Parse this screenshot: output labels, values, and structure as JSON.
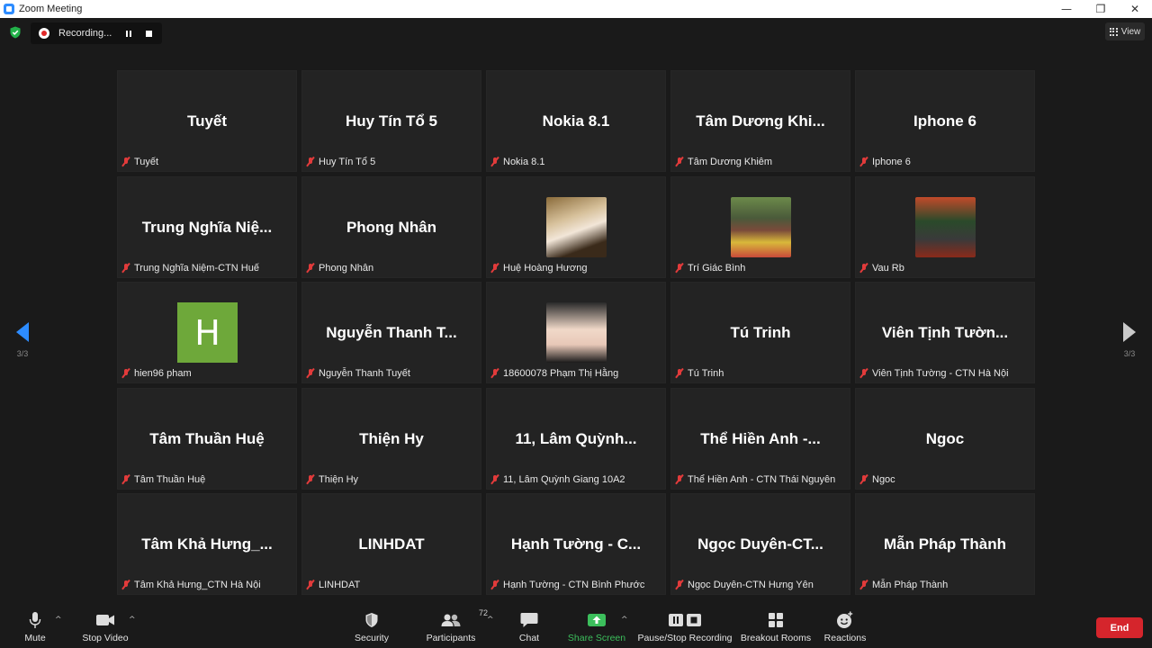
{
  "window": {
    "title": "Zoom Meeting"
  },
  "recording": {
    "label": "Recording..."
  },
  "view_button": {
    "label": "View"
  },
  "pagination": {
    "left": "3/3",
    "right": "3/3"
  },
  "participants": [
    {
      "display": "Tuyết",
      "name": "Tuyết",
      "avatar": ""
    },
    {
      "display": "Huy Tín Tổ 5",
      "name": "Huy Tín Tổ 5",
      "avatar": ""
    },
    {
      "display": "Nokia 8.1",
      "name": "Nokia 8.1",
      "avatar": ""
    },
    {
      "display": "Tâm Dương Khi...",
      "name": "Tâm Dương Khiêm",
      "avatar": ""
    },
    {
      "display": "Iphone 6",
      "name": "Iphone 6",
      "avatar": ""
    },
    {
      "display": "Trung Nghĩa Niệ...",
      "name": "Trung Nghĩa Niệm-CTN Huế",
      "avatar": ""
    },
    {
      "display": "Phong Nhân",
      "name": "Phong Nhân",
      "avatar": ""
    },
    {
      "display": "",
      "name": "Huệ Hoàng Hương",
      "avatar": "photo-1"
    },
    {
      "display": "",
      "name": "Trí Giác Bình",
      "avatar": "photo-2"
    },
    {
      "display": "",
      "name": "Vau Rb",
      "avatar": "photo-3"
    },
    {
      "display": "",
      "name": "hien96 pham",
      "avatar": "letter",
      "letter": "H"
    },
    {
      "display": "Nguyễn Thanh T...",
      "name": "Nguyễn Thanh Tuyết",
      "avatar": ""
    },
    {
      "display": "",
      "name": "18600078 Phạm Thị Hằng",
      "avatar": "photo-4"
    },
    {
      "display": "Tú Trinh",
      "name": "Tú Trinh",
      "avatar": ""
    },
    {
      "display": "Viên Tịnh Tườn...",
      "name": "Viên Tịnh Tường - CTN Hà Nội",
      "avatar": ""
    },
    {
      "display": "Tâm Thuần Huệ",
      "name": "Tâm Thuần Huệ",
      "avatar": ""
    },
    {
      "display": "Thiện Hy",
      "name": "Thiện Hy",
      "avatar": ""
    },
    {
      "display": "11, Lâm Quỳnh...",
      "name": "11, Lâm Quỳnh Giang 10A2",
      "avatar": ""
    },
    {
      "display": "Thể Hiền Anh -...",
      "name": "Thể Hiền Anh - CTN Thái Nguyên",
      "avatar": ""
    },
    {
      "display": "Ngoc",
      "name": "Ngoc",
      "avatar": ""
    },
    {
      "display": "Tâm Khả Hưng_...",
      "name": "Tâm Khả Hưng_CTN Hà Nội",
      "avatar": ""
    },
    {
      "display": "LINHDAT",
      "name": "LINHDAT",
      "avatar": ""
    },
    {
      "display": "Hạnh Tường - C...",
      "name": "Hạnh Tường - CTN Bình Phước",
      "avatar": ""
    },
    {
      "display": "Ngọc Duyên-CT...",
      "name": "Ngọc Duyên-CTN Hưng Yên",
      "avatar": ""
    },
    {
      "display": "Mẫn Pháp Thành",
      "name": "Mẫn Pháp Thành",
      "avatar": ""
    }
  ],
  "toolbar": {
    "mute": "Mute",
    "stop_video": "Stop Video",
    "security": "Security",
    "participants": "Participants",
    "participants_count": "72",
    "chat": "Chat",
    "share_screen": "Share Screen",
    "pause_recording": "Pause/Stop Recording",
    "breakout_rooms": "Breakout Rooms",
    "reactions": "Reactions",
    "end": "End"
  },
  "colors": {
    "accent": "#2d8cff",
    "share_green": "#3cbf5c",
    "end_red": "#d5252c",
    "muted_red": "#e23b3b"
  }
}
